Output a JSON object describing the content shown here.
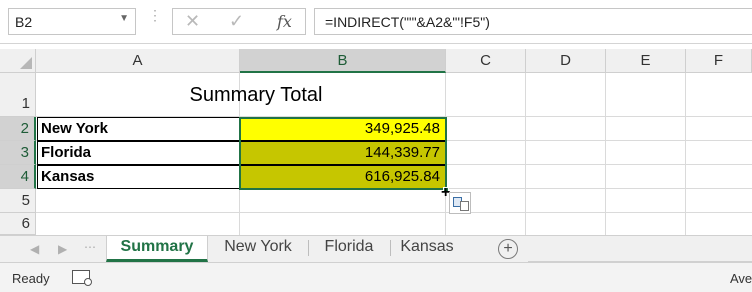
{
  "formula_bar": {
    "name_box": "B2",
    "cancel_icon": "✕",
    "enter_icon": "✓",
    "fx_icon": "fx",
    "formula": "=INDIRECT(\"'\"&A2&\"'!F5\")"
  },
  "columns": [
    "A",
    "B",
    "C",
    "D",
    "E",
    "F"
  ],
  "rows": [
    "1",
    "2",
    "3",
    "4",
    "5",
    "6"
  ],
  "sheet": {
    "title": "Summary Total",
    "data": [
      {
        "state": "New York",
        "amount": "349,925.48"
      },
      {
        "state": "Florida",
        "amount": "144,339.77"
      },
      {
        "state": "Kansas",
        "amount": "616,925.84"
      }
    ]
  },
  "tabs": {
    "items": [
      "Summary",
      "New York",
      "Florida",
      "Kansas"
    ],
    "active": "Summary",
    "add_label": "+"
  },
  "status": {
    "ready": "Ready",
    "right_text": "Ave"
  },
  "colors": {
    "accent": "#217346",
    "highlight_yellow": "#ffff00",
    "highlight_olive": "#c6c600"
  }
}
